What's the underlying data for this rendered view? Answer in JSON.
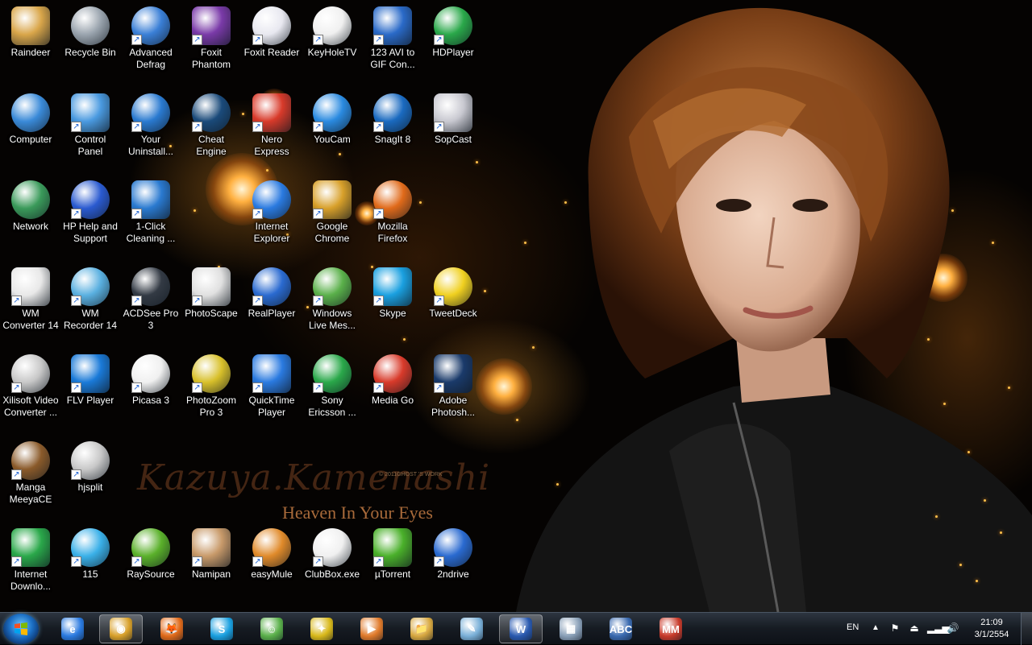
{
  "wallpaper": {
    "title": "Kazuya.Kamenashi",
    "subtitle": "Heaven In Your Eyes",
    "credit": "© 2011GHOST 'S WORK"
  },
  "desktop_icons": [
    {
      "label": "Raindeer",
      "icon": "user-folder-icon",
      "color": "#d9a64a"
    },
    {
      "label": "Recycle Bin",
      "icon": "recycle-bin-icon",
      "color": "#9aa4ae"
    },
    {
      "label": "Advanced Defrag",
      "icon": "advanced-defrag-icon",
      "color": "#3a7fd6"
    },
    {
      "label": "Foxit Phantom",
      "icon": "foxit-phantom-icon",
      "color": "#7a3aa8"
    },
    {
      "label": "Foxit Reader",
      "icon": "foxit-reader-icon",
      "color": "#e8e8f0"
    },
    {
      "label": "KeyHoleTV",
      "icon": "keyholetv-icon",
      "color": "#f0f0f0"
    },
    {
      "label": "123 AVI to GIF Con...",
      "icon": "avi-to-gif-icon",
      "color": "#2a6ac8"
    },
    {
      "label": "HDPlayer",
      "icon": "hdplayer-icon",
      "color": "#2aa84a"
    },
    {
      "label": "Computer",
      "icon": "computer-icon",
      "color": "#3a8ad8"
    },
    {
      "label": "Control Panel",
      "icon": "control-panel-icon",
      "color": "#4a9ae0"
    },
    {
      "label": "Your Uninstall...",
      "icon": "your-uninstaller-icon",
      "color": "#2a7ad0"
    },
    {
      "label": "Cheat Engine",
      "icon": "cheat-engine-icon",
      "color": "#1a4a7a"
    },
    {
      "label": "Nero Express",
      "icon": "nero-express-icon",
      "color": "#d83a2a"
    },
    {
      "label": "YouCam",
      "icon": "youcam-icon",
      "color": "#2a8ae0"
    },
    {
      "label": "SnagIt 8",
      "icon": "snagit-icon",
      "color": "#1a6ac0"
    },
    {
      "label": "SopCast",
      "icon": "sopcast-icon",
      "color": "#c8c8d0"
    },
    {
      "label": "Network",
      "icon": "network-icon",
      "color": "#3a9a5a"
    },
    {
      "label": "HP Help and Support",
      "icon": "help-icon",
      "color": "#2a5ad0"
    },
    {
      "label": "1-Click Cleaning ...",
      "icon": "one-click-cleaning-icon",
      "color": "#2a7ad0"
    },
    {
      "label": "",
      "icon": "",
      "color": ""
    },
    {
      "label": "Internet Explorer",
      "icon": "internet-explorer-icon",
      "color": "#2a7ae0"
    },
    {
      "label": "Google Chrome",
      "icon": "chrome-icon",
      "color": "#d8a02a"
    },
    {
      "label": "Mozilla Firefox",
      "icon": "firefox-icon",
      "color": "#e06a1a"
    },
    {
      "label": "",
      "icon": "",
      "color": ""
    },
    {
      "label": "WM Converter 14",
      "icon": "wm-converter-icon",
      "color": "#e8e8e8"
    },
    {
      "label": "WM Recorder 14",
      "icon": "wm-recorder-icon",
      "color": "#5ab0e0"
    },
    {
      "label": "ACDSee Pro 3",
      "icon": "acdsee-icon",
      "color": "#333a44"
    },
    {
      "label": "PhotoScape",
      "icon": "photoscape-icon",
      "color": "#e0e0e0"
    },
    {
      "label": "RealPlayer",
      "icon": "realplayer-icon",
      "color": "#2a6ad0"
    },
    {
      "label": "Windows Live Mes...",
      "icon": "live-messenger-icon",
      "color": "#5ab04a"
    },
    {
      "label": "Skype",
      "icon": "skype-icon",
      "color": "#1aa0e0"
    },
    {
      "label": "TweetDeck",
      "icon": "tweetdeck-icon",
      "color": "#f0d020"
    },
    {
      "label": "Xilisoft Video Converter ...",
      "icon": "film-reel-icon",
      "color": "#c8c8c8"
    },
    {
      "label": "FLV Player",
      "icon": "flv-player-icon",
      "color": "#1a7ad8"
    },
    {
      "label": "Picasa 3",
      "icon": "picasa-icon",
      "color": "#f0f0f0"
    },
    {
      "label": "PhotoZoom Pro 3",
      "icon": "photozoom-icon",
      "color": "#d8c02a"
    },
    {
      "label": "QuickTime Player",
      "icon": "quicktime-icon",
      "color": "#2a7ae0"
    },
    {
      "label": "Sony Ericsson ...",
      "icon": "sony-ericsson-icon",
      "color": "#2aa84a"
    },
    {
      "label": "Media Go",
      "icon": "media-go-icon",
      "color": "#d83a2a"
    },
    {
      "label": "Adobe Photosh...",
      "icon": "photoshop-icon",
      "color": "#1a3a6a"
    },
    {
      "label": "Manga MeeyaCE",
      "icon": "manga-meeya-icon",
      "color": "#8a5a2a"
    },
    {
      "label": "hjsplit",
      "icon": "hjsplit-icon",
      "color": "#c8c8c8"
    },
    {
      "label": "",
      "icon": "",
      "color": ""
    },
    {
      "label": "",
      "icon": "",
      "color": ""
    },
    {
      "label": "",
      "icon": "",
      "color": ""
    },
    {
      "label": "",
      "icon": "",
      "color": ""
    },
    {
      "label": "",
      "icon": "",
      "color": ""
    },
    {
      "label": "",
      "icon": "",
      "color": ""
    },
    {
      "label": "Internet Downlo...",
      "icon": "internet-download-manager-icon",
      "color": "#2aa84a"
    },
    {
      "label": "115",
      "icon": "115-icon",
      "color": "#3ab0e8"
    },
    {
      "label": "RaySource",
      "icon": "raysource-icon",
      "color": "#5ab02a"
    },
    {
      "label": "Namipan",
      "icon": "namipan-icon",
      "color": "#c89a6a"
    },
    {
      "label": "easyMule",
      "icon": "easymule-icon",
      "color": "#e08a2a"
    },
    {
      "label": "ClubBox.exe",
      "icon": "clubbox-icon",
      "color": "#f0f0f0"
    },
    {
      "label": "µTorrent",
      "icon": "utorrent-icon",
      "color": "#4ab02a"
    },
    {
      "label": "2ndrive",
      "icon": "2ndrive-icon",
      "color": "#2a6ad0"
    }
  ],
  "taskbar": {
    "start_label": "Start",
    "pinned": [
      {
        "name": "internet-explorer",
        "glyph": "e",
        "color": "#2a7ae0",
        "active": false
      },
      {
        "name": "chrome",
        "glyph": "◉",
        "color": "#d8a02a",
        "active": true
      },
      {
        "name": "firefox",
        "glyph": "🦊",
        "color": "#e06a1a",
        "active": false
      },
      {
        "name": "skype",
        "glyph": "S",
        "color": "#1aa0e0",
        "active": false
      },
      {
        "name": "live-messenger",
        "glyph": "☺",
        "color": "#5ab04a",
        "active": false
      },
      {
        "name": "tweetdeck",
        "glyph": "✦",
        "color": "#d8b81a",
        "active": false
      },
      {
        "name": "media-player",
        "glyph": "▶",
        "color": "#e07a2a",
        "active": false
      },
      {
        "name": "file-explorer",
        "glyph": "📁",
        "color": "#d8a840",
        "active": false
      },
      {
        "name": "notepad",
        "glyph": "✎",
        "color": "#7ab0d8",
        "active": false
      },
      {
        "name": "word",
        "glyph": "W",
        "color": "#2a5ab0",
        "active": true
      },
      {
        "name": "calculator",
        "glyph": "▦",
        "color": "#8aa0b8",
        "active": false
      },
      {
        "name": "abc-dictionary",
        "glyph": "ABC",
        "color": "#3a6ab0",
        "active": false
      },
      {
        "name": "mma-app",
        "glyph": "MM",
        "color": "#c83a2a",
        "active": false
      }
    ],
    "tray": {
      "language": "EN",
      "time": "21:09",
      "date": "3/1/2554"
    }
  }
}
